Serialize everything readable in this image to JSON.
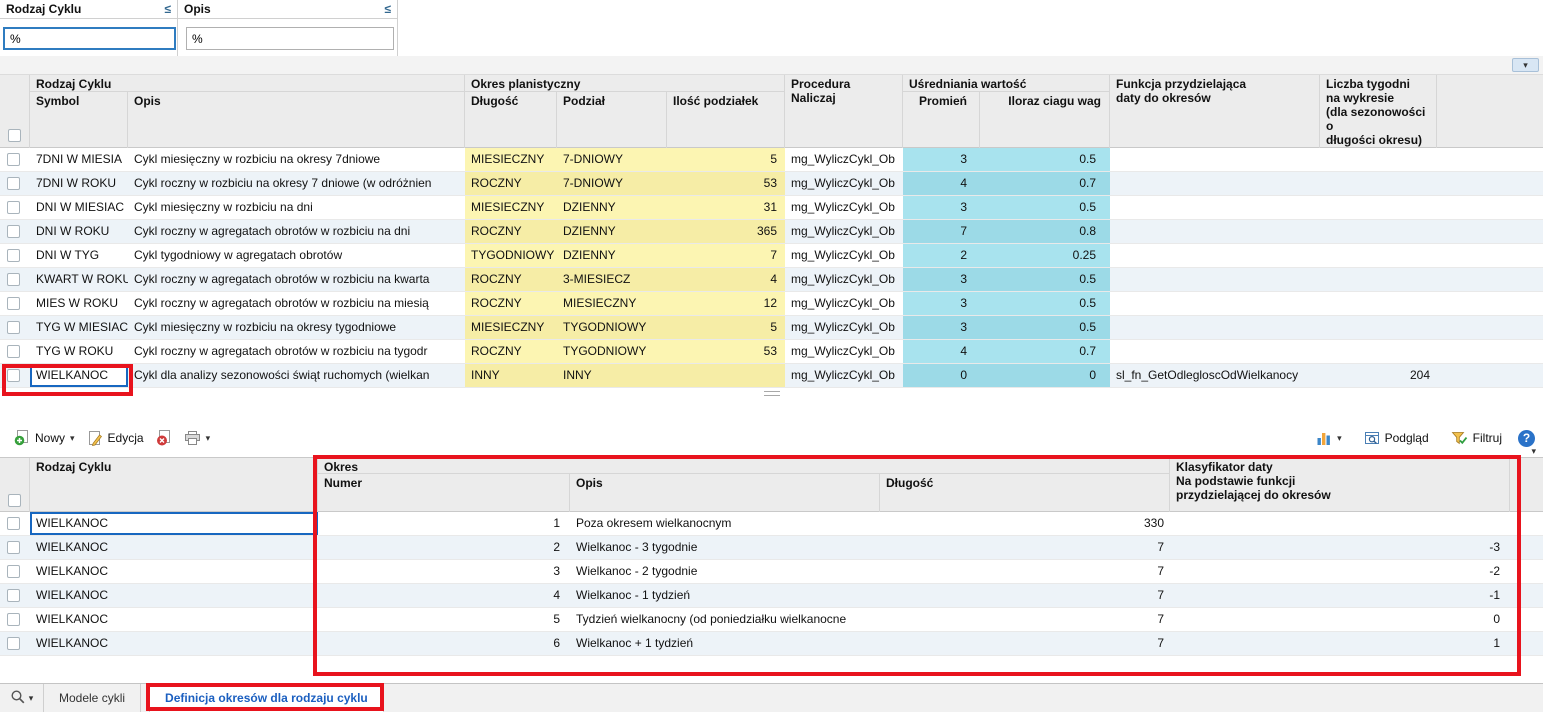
{
  "colors": {
    "accent_blue": "#1767c0",
    "annotation_red": "#e8131d",
    "planning_yellow": "#fcf5b2",
    "average_cyan": "#a8e3ee",
    "active_tab_blue": "#1b5fc0"
  },
  "icons": {
    "chevron_down": "▾"
  },
  "filter_panel": {
    "filters": [
      {
        "label": "Rodzaj Cyklu",
        "operator": "≤",
        "value": "%"
      },
      {
        "label": "Opis",
        "operator": "≤",
        "value": "%"
      }
    ]
  },
  "main_grid": {
    "header": {
      "rodzaj_cyklu_group": "Rodzaj Cyklu",
      "symbol": "Symbol",
      "opis": "Opis",
      "okres_planistyczny_group": "Okres planistyczny",
      "dlugosc": "Długość",
      "podzial": "Podział",
      "ilosc_podzialek": "Ilość podziałek",
      "procedura": "Procedura Naliczaj",
      "usredniania_group": "Uśredniania wartość",
      "promien": "Promień",
      "iloraz": "Iloraz ciagu wag",
      "funkcja": "Funkcja przydzielająca\ndaty do okresów",
      "liczba_tygodni": "Liczba tygodni\nna wykresie\n(dla sezonowości o\ndługości okresu)"
    },
    "rows": [
      {
        "symbol": "7DNI W MIESIA",
        "opis": "Cykl miesięczny w rozbiciu na okresy 7dniowe",
        "dlugosc": "MIESIECZNY",
        "podzial": "7-DNIOWY",
        "ilosc": "5",
        "procedura": "mg_WyliczCykl_Ob",
        "promien": "3",
        "iloraz": "0.5",
        "funkcja": "",
        "liczba": ""
      },
      {
        "symbol": "7DNI W ROKU",
        "opis": "Cykl roczny w rozbiciu na okresy 7 dniowe (w odróżnien",
        "dlugosc": "ROCZNY",
        "podzial": "7-DNIOWY",
        "ilosc": "53",
        "procedura": "mg_WyliczCykl_Ob",
        "promien": "4",
        "iloraz": "0.7",
        "funkcja": "",
        "liczba": ""
      },
      {
        "symbol": "DNI W MIESIAC",
        "opis": "Cykl miesięczny w rozbiciu na dni",
        "dlugosc": "MIESIECZNY",
        "podzial": "DZIENNY",
        "ilosc": "31",
        "procedura": "mg_WyliczCykl_Ob",
        "promien": "3",
        "iloraz": "0.5",
        "funkcja": "",
        "liczba": ""
      },
      {
        "symbol": "DNI W ROKU",
        "opis": "Cykl roczny w agregatach obrotów w rozbiciu na dni",
        "dlugosc": "ROCZNY",
        "podzial": "DZIENNY",
        "ilosc": "365",
        "procedura": "mg_WyliczCykl_Ob",
        "promien": "7",
        "iloraz": "0.8",
        "funkcja": "",
        "liczba": ""
      },
      {
        "symbol": "DNI W TYG",
        "opis": "Cykl tygodniowy w agregatach obrotów",
        "dlugosc": "TYGODNIOWY",
        "podzial": "DZIENNY",
        "ilosc": "7",
        "procedura": "mg_WyliczCykl_Ob",
        "promien": "2",
        "iloraz": "0.25",
        "funkcja": "",
        "liczba": ""
      },
      {
        "symbol": "KWART W ROKU",
        "opis": "Cykl roczny w agregatach obrotów w rozbiciu na kwarta",
        "dlugosc": "ROCZNY",
        "podzial": "3-MIESIECZ",
        "ilosc": "4",
        "procedura": "mg_WyliczCykl_Ob",
        "promien": "3",
        "iloraz": "0.5",
        "funkcja": "",
        "liczba": ""
      },
      {
        "symbol": "MIES W ROKU",
        "opis": "Cykl roczny w agregatach obrotów w rozbiciu na miesią",
        "dlugosc": "ROCZNY",
        "podzial": "MIESIECZNY",
        "ilosc": "12",
        "procedura": "mg_WyliczCykl_Ob",
        "promien": "3",
        "iloraz": "0.5",
        "funkcja": "",
        "liczba": ""
      },
      {
        "symbol": "TYG W MIESIAC",
        "opis": "Cykl miesięczny w rozbiciu na okresy tygodniowe",
        "dlugosc": "MIESIECZNY",
        "podzial": "TYGODNIOWY",
        "ilosc": "5",
        "procedura": "mg_WyliczCykl_Ob",
        "promien": "3",
        "iloraz": "0.5",
        "funkcja": "",
        "liczba": ""
      },
      {
        "symbol": "TYG W ROKU",
        "opis": "Cykl roczny w agregatach obrotów w rozbiciu na tygodr",
        "dlugosc": "ROCZNY",
        "podzial": "TYGODNIOWY",
        "ilosc": "53",
        "procedura": "mg_WyliczCykl_Ob",
        "promien": "4",
        "iloraz": "0.7",
        "funkcja": "",
        "liczba": ""
      },
      {
        "symbol": "WIELKANOC",
        "opis": "Cykl dla analizy sezonowości świąt ruchomych (wielkan",
        "dlugosc": "INNY",
        "podzial": "INNY",
        "ilosc": "",
        "procedura": "mg_WyliczCykl_Ob",
        "promien": "0",
        "iloraz": "0",
        "funkcja": "sl_fn_GetOdlegloscOdWielkanocy",
        "liczba": "204"
      }
    ]
  },
  "toolbar": {
    "nowy_label": "Nowy",
    "edycja_label": "Edycja",
    "podglad_label": "Podgląd",
    "filtruj_label": "Filtruj",
    "help_label": "?"
  },
  "detail_grid": {
    "header": {
      "rodzaj_cyklu": "Rodzaj Cyklu",
      "okres_group": "Okres",
      "numer": "Numer",
      "opis": "Opis",
      "dlugosc": "Długość",
      "klasyfikator": "Klasyfikator daty\nNa podstawie funkcji\nprzydzielającej do okresów"
    },
    "rows": [
      {
        "rodzaj": "WIELKANOC",
        "numer": "1",
        "opis": "Poza okresem wielkanocnym",
        "dlugosc": "330",
        "klasyfikator": ""
      },
      {
        "rodzaj": "WIELKANOC",
        "numer": "2",
        "opis": "Wielkanoc - 3 tygodnie",
        "dlugosc": "7",
        "klasyfikator": "-3"
      },
      {
        "rodzaj": "WIELKANOC",
        "numer": "3",
        "opis": "Wielkanoc - 2 tygodnie",
        "dlugosc": "7",
        "klasyfikator": "-2"
      },
      {
        "rodzaj": "WIELKANOC",
        "numer": "4",
        "opis": "Wielkanoc - 1 tydzień",
        "dlugosc": "7",
        "klasyfikator": "-1"
      },
      {
        "rodzaj": "WIELKANOC",
        "numer": "5",
        "opis": "Tydzień wielkanocny (od poniedziałku wielkanocne",
        "dlugosc": "7",
        "klasyfikator": "0"
      },
      {
        "rodzaj": "WIELKANOC",
        "numer": "6",
        "opis": "Wielkanoc + 1 tydzień",
        "dlugosc": "7",
        "klasyfikator": "1"
      }
    ]
  },
  "tab_bar": {
    "tabs": [
      {
        "label": "Modele cykli",
        "active": false
      },
      {
        "label": "Definicja okresów dla rodzaju cyklu",
        "active": true
      }
    ]
  }
}
